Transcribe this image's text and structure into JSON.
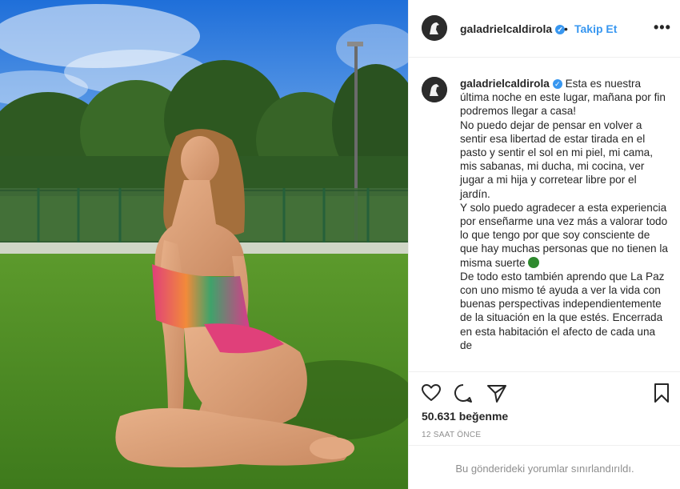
{
  "post": {
    "username": "galadrielcaldirola",
    "separator": "•",
    "follow_label": "Takip Et",
    "more_label": "•••",
    "caption_paragraphs": [
      "Esta es nuestra última noche en este lugar, mañana por fin podremos llegar a casa!",
      "No puedo dejar de pensar en volver a sentir esa libertad de estar tirada en el pasto y sentir el sol en mi piel, mi cama, mis sabanas, mi ducha, mi cocina, ver jugar a mi hija y corretear libre por el jardín.",
      "Y solo puedo agradecer a esta experiencia por enseñarme una vez más a valorar todo lo que tengo por que soy consciente de que hay muchas personas que no tienen la misma suerte",
      "De todo esto también aprendo que La Paz con uno mismo té ayuda a ver la vida con buenas perspectivas independientemente de la situación en la que estés. Encerrada en esta habitación el afecto de cada una de"
    ],
    "likes": "50.631 beğenme",
    "time_ago": "12 SAAT ÖNCE",
    "comments_disabled": "Bu gönderideki yorumlar sınırlandırıldı."
  },
  "icons": {
    "like": "heart-icon",
    "comment": "comment-icon",
    "share": "share-icon",
    "save": "bookmark-icon",
    "verified": "verified-badge-icon",
    "clover": "four-leaf-clover-icon"
  },
  "colors": {
    "link_blue": "#3897f0",
    "text": "#262626",
    "muted": "#8e8e8e"
  }
}
